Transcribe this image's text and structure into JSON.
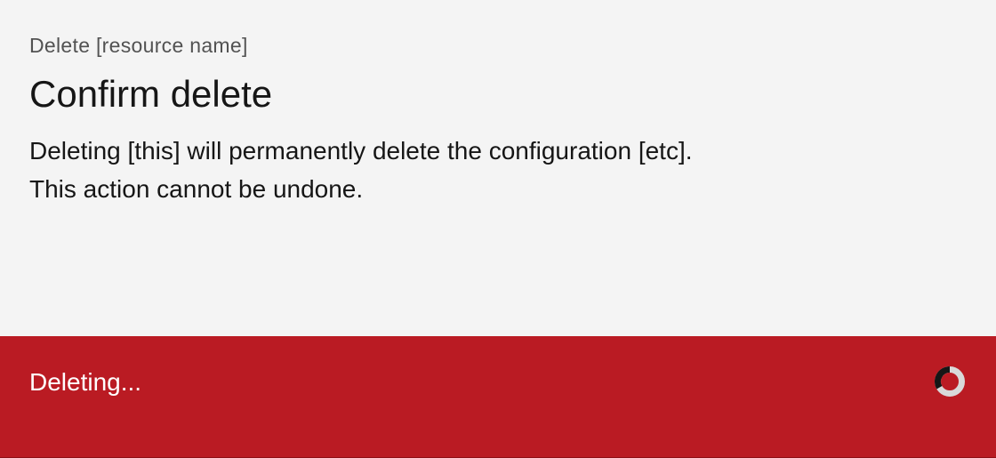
{
  "modal": {
    "label": "Delete [resource name]",
    "heading": "Confirm delete",
    "body": "Deleting [this] will permanently delete the configuration [etc]. This action cannot be undone."
  },
  "footer": {
    "status_text": "Deleting...",
    "loading_icon": "loading-spinner-icon"
  },
  "colors": {
    "background": "#f4f4f4",
    "danger": "#ba1b23",
    "text_primary": "#161616",
    "text_secondary": "#525252",
    "footer_text": "#ffffff"
  }
}
